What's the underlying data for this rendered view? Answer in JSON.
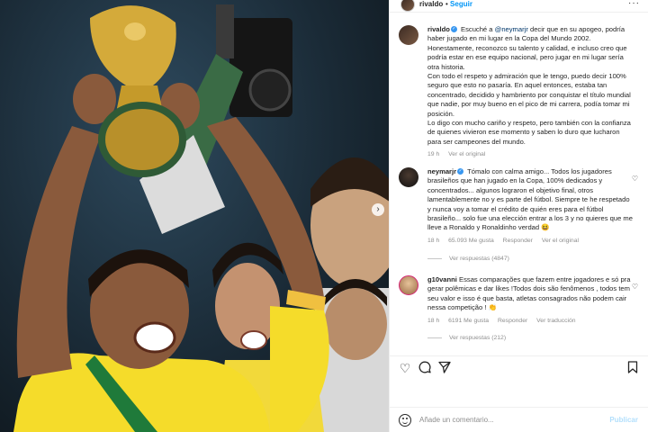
{
  "header": {
    "username": "rivaldo",
    "separator": "•",
    "follow_label": "Seguir",
    "more": "···"
  },
  "comments": [
    {
      "username": "rivaldo",
      "verified": true,
      "text_before_mention": "Escuché a ",
      "mention": "@neymarjr",
      "text_after_mention": " decir que en su apogeo, podría haber jugado en mi lugar en la Copa del Mundo 2002. Honestamente, reconozco su talento y calidad, e incluso creo que podría estar en ese equipo nacional, pero jugar en mi lugar sería otra historia.",
      "paragraph2": "Con todo el respeto y admiración que le tengo, puedo decir 100% seguro que esto no pasaría. En aquel entonces, estaba tan concentrado, decidido y hambriento por conquistar el título mundial que nadie, por muy bueno en el pico de mi carrera, podía tomar mi posición.",
      "paragraph3": "Lo digo con mucho cariño y respeto, pero también con la confianza de quienes vivieron ese momento y saben lo duro que lucharon para ser campeones del mundo.",
      "time": "19 h",
      "translate": "Ver el original"
    },
    {
      "username": "neymarjr",
      "verified": true,
      "text": "Tómalo con calma amigo... Todos los jugadores brasileños que han jugado en la Copa, 100% dedicados y concentrados... algunos lograron el objetivo final, otros lamentablemente no y es parte del fútbol. Siempre te he respetado y nunca voy a tomar el crédito de quién eres para el fútbol brasileño... solo fue una elección entrar a los 3 y no quieres que me lleve a Ronaldo y Ronaldinho verdad 😆",
      "time": "18 h",
      "likes": "65.093 Me gusta",
      "reply": "Responder",
      "translate": "Ver el original",
      "view_replies": "Ver respuestas (4847)"
    },
    {
      "username": "g10vanni",
      "verified": false,
      "text": "Essas comparações que fazem entre jogadores e só pra gerar polêmicas e dar likes !Todos dois são fenômenos , todos tem seu valor e isso é que basta, atletas consagrados não podem cair nessa competição ! 👏",
      "time": "18 h",
      "likes": "6191 Me gusta",
      "reply": "Responder",
      "translate": "Ver traducción",
      "view_replies": "Ver respuestas (212)"
    }
  ],
  "icons": {
    "heart": "heart-icon",
    "comment": "comment-icon",
    "share": "share-icon",
    "save": "bookmark-icon",
    "emoji": "emoji-icon",
    "next": "chevron-right-icon"
  },
  "add_comment": {
    "placeholder": "Añade un comentario...",
    "post_label": "Publicar"
  },
  "colors": {
    "link_blue": "#0095f6",
    "mention": "#00376b",
    "muted": "#8e8e8e",
    "post_disabled": "#b2dffc"
  }
}
